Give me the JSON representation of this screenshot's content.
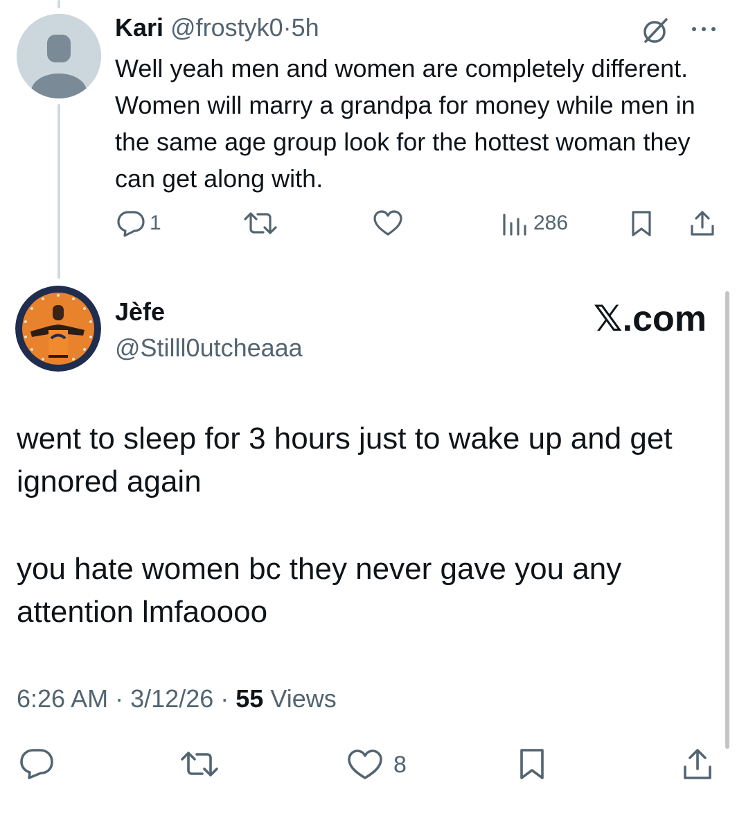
{
  "reply": {
    "display_name": "Kari",
    "handle": "@frostyk0",
    "separator": "·",
    "time_ago": "5h",
    "text": "Well yeah men and women are completely different. Women will marry a grandpa for money while men in the same age group look for the hottest woman they can get along with.",
    "replies": "1",
    "views": "286",
    "icons": [
      "grok-icon",
      "more-icon",
      "reply-icon",
      "retweet-icon",
      "like-icon",
      "views-icon",
      "bookmark-icon",
      "share-icon"
    ]
  },
  "main": {
    "display_name": "Jèfe",
    "handle": "@Stilll0utcheaaa",
    "brand": "𝕏.com",
    "paragraph_1": "went to sleep for 3 hours just to wake up and get ignored again",
    "paragraph_2": "you hate women bc they never gave you any attention lmfaoooo",
    "time": "6:26 AM",
    "date": "3/12/26",
    "views_count": "55",
    "views_label": "Views",
    "separator": "·",
    "likes": "8",
    "icons": [
      "reply-icon",
      "retweet-icon",
      "like-icon",
      "bookmark-icon",
      "share-icon"
    ]
  },
  "colors": {
    "text": "#0f1419",
    "secondary": "#536471",
    "thread_line": "#cfd9de",
    "avatar_bg": "#ccd6dd",
    "avatar_fg": "#7a8a97",
    "avatar_orange": "#e8822c",
    "avatar_navy": "#1f2d4e"
  }
}
